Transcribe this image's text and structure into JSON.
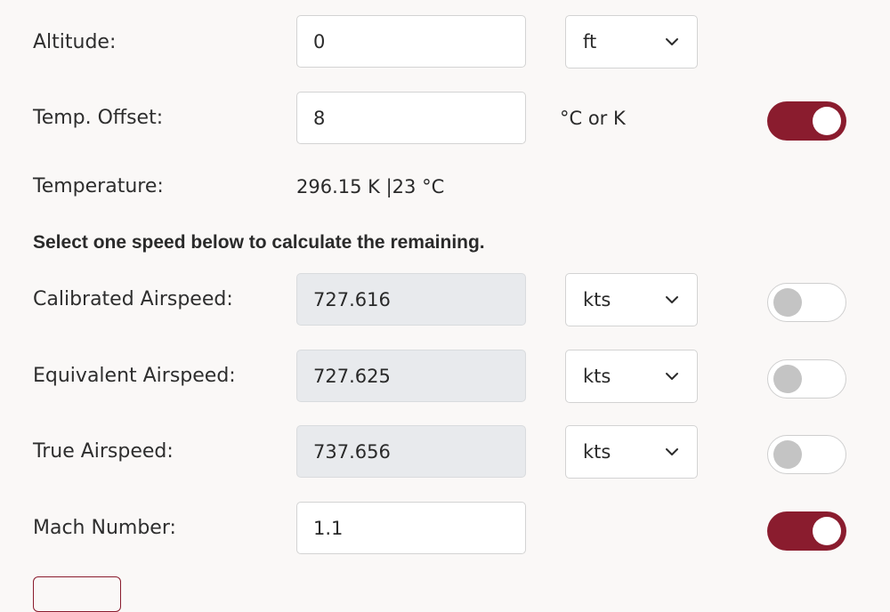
{
  "fields": {
    "altitude": {
      "label": "Altitude:",
      "value": "0",
      "unit": "ft"
    },
    "temp_offset": {
      "label": "Temp. Offset:",
      "value": "8",
      "unit_text": "°C or K",
      "toggle_on": true
    },
    "temperature": {
      "label": "Temperature:",
      "value": "296.15 K |23 °C"
    }
  },
  "speed_section": {
    "heading": "Select one speed below to calculate the remaining."
  },
  "speeds": {
    "calibrated": {
      "label": "Calibrated Airspeed:",
      "value": "727.616",
      "unit": "kts",
      "toggle_on": false
    },
    "equivalent": {
      "label": "Equivalent Airspeed:",
      "value": "727.625",
      "unit": "kts",
      "toggle_on": false
    },
    "true_airspeed": {
      "label": "True Airspeed:",
      "value": "737.656",
      "unit": "kts",
      "toggle_on": false
    },
    "mach": {
      "label": "Mach Number:",
      "value": "1.1",
      "toggle_on": true
    }
  },
  "colors": {
    "accent": "#8a1c2e",
    "background": "#faf8f7",
    "readonly_field": "#e8eaed",
    "toggle_off_knob": "#c4c4c4"
  },
  "icons": {
    "select_chevron": "chevron-down-icon"
  }
}
